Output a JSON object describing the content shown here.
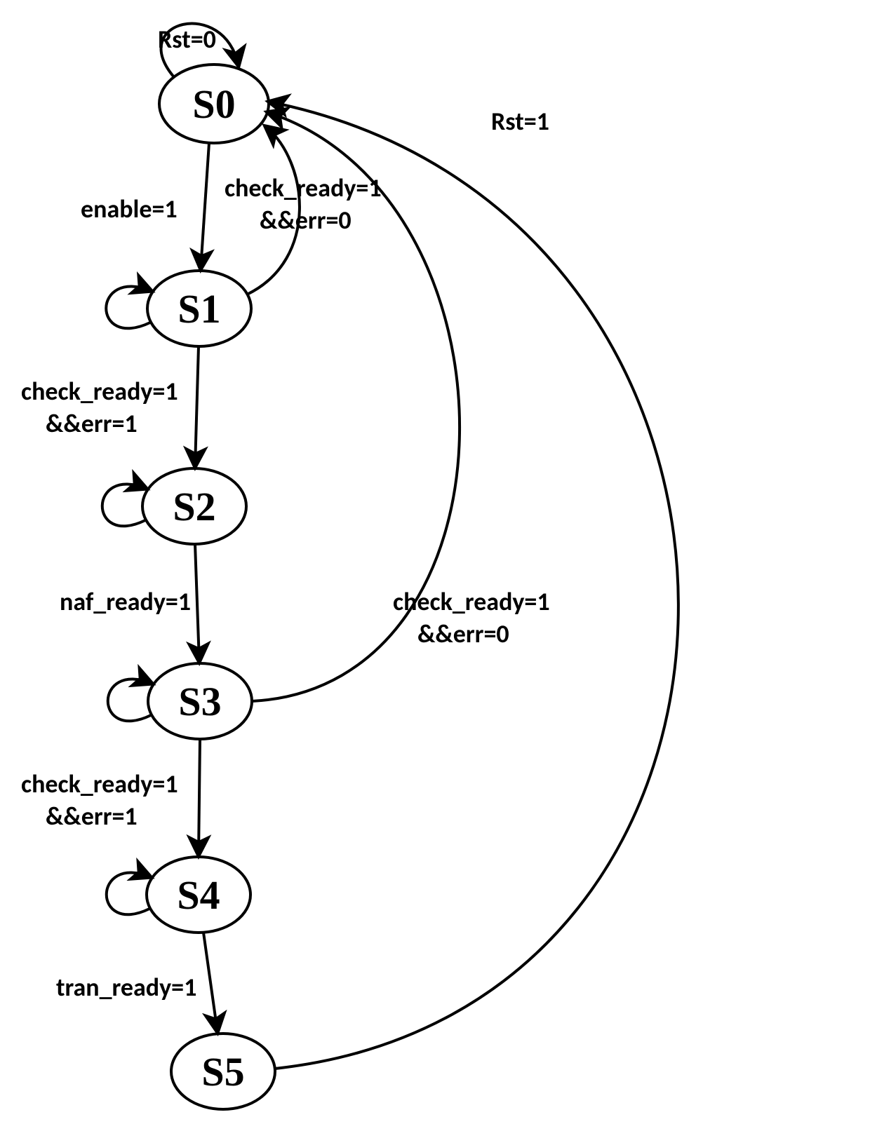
{
  "states": {
    "s0": "S0",
    "s1": "S1",
    "s2": "S2",
    "s3": "S3",
    "s4": "S4",
    "s5": "S5"
  },
  "edges": {
    "s0_self": "Rst=0",
    "s0_s1": "enable=1",
    "s1_s0_a": "check_ready=1",
    "s1_s0_b": "&&err=0",
    "s1_s2_a": "check_ready=1",
    "s1_s2_b": "&&err=1",
    "s2_s3": "naf_ready=1",
    "s3_s0_a": "check_ready=1",
    "s3_s0_b": "&&err=0",
    "s3_s4_a": "check_ready=1",
    "s3_s4_b": "&&err=1",
    "s4_s5": "tran_ready=1",
    "s5_s0": "Rst=1"
  }
}
